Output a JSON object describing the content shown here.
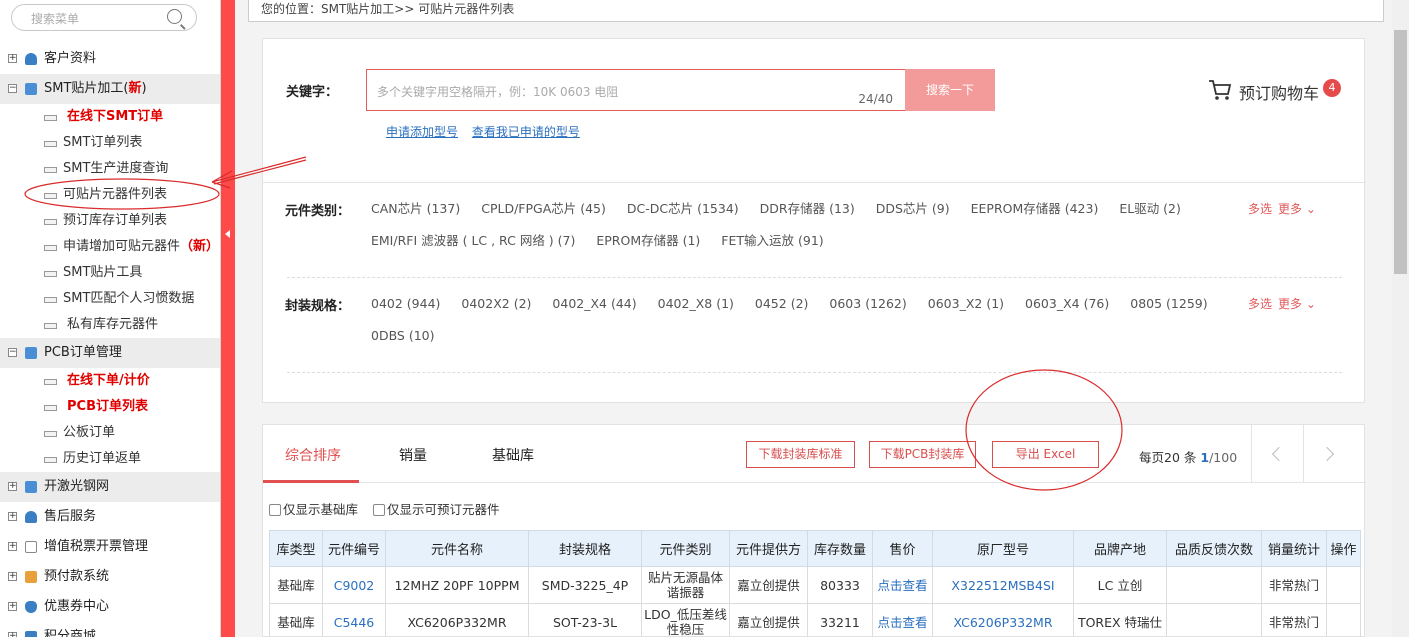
{
  "sidebar": {
    "search_placeholder": "搜索菜单",
    "groups": [
      {
        "label": "客户资料",
        "expander": "+",
        "icon": "user-icon",
        "color": "#3a7fc4"
      },
      {
        "label": "SMT贴片加工(",
        "new": "新",
        "close": ")",
        "expander": "−",
        "icon": "book-icon",
        "color": "#4a8ed6"
      },
      {
        "label": "PCB订单管理",
        "expander": "−",
        "icon": "book-icon",
        "color": "#4a8ed6"
      },
      {
        "label": "开激光钢网",
        "expander": "+",
        "icon": "book-icon",
        "color": "#4a8ed6"
      },
      {
        "label": "售后服务",
        "expander": "+",
        "icon": "user-icon",
        "color": "#3a7fc4"
      },
      {
        "label": "增值税票开票管理",
        "expander": "+",
        "icon": "document-icon",
        "color": "#888888"
      },
      {
        "label": "预付款系统",
        "expander": "+",
        "icon": "money-icon",
        "color": "#e8a13a"
      },
      {
        "label": "优惠券中心",
        "expander": "+",
        "icon": "shield-icon",
        "color": "#3a7fc4"
      },
      {
        "label": "积分商城",
        "expander": "+",
        "icon": "gift-icon",
        "color": "#3a7fc4"
      }
    ],
    "smt_items": [
      {
        "label": "在线下SMT订单"
      },
      {
        "label": "SMT订单列表"
      },
      {
        "label": "SMT生产进度查询"
      },
      {
        "label": "可贴片元器件列表"
      },
      {
        "label": "预订库存订单列表"
      },
      {
        "label": "申请增加可贴元器件",
        "new": "（新）"
      },
      {
        "label": "SMT贴片工具"
      },
      {
        "label": "SMT匹配个人习惯数据"
      },
      {
        "label": "私有库存元器件"
      }
    ],
    "pcb_items": [
      {
        "label": "在线下单/计价"
      },
      {
        "label": "PCB订单列表"
      },
      {
        "label": "公板订单"
      },
      {
        "label": "历史订单返单"
      }
    ]
  },
  "breadcrumb": "您的位置：SMT贴片加工>>  可贴片元器件列表",
  "search": {
    "label": "关键字：",
    "placeholder": "多个关键字用空格隔开，例：10K 0603 电阻",
    "counter": "24/40",
    "button": "搜索一下",
    "link_apply": "申请添加型号",
    "link_view": "查看我已申请的型号"
  },
  "cart": {
    "label": "预订购物车",
    "count": "4"
  },
  "filters": {
    "category": {
      "title": "元件类别：",
      "options": [
        "CAN芯片 (137)",
        "CPLD/FPGA芯片 (45)",
        "DC-DC芯片 (1534)",
        "DDR存储器 (13)",
        "DDS芯片 (9)",
        "EEPROM存储器 (423)",
        "EL驱动 (2)",
        "EMI/RFI 滤波器 ( LC , RC 网络 ) (7)",
        "EPROM存储器 (1)",
        "FET输入运放 (91)"
      ],
      "multi": "多选",
      "more": "更多"
    },
    "package": {
      "title": "封装规格：",
      "options": [
        "0402 (944)",
        "0402X2 (2)",
        "0402_X4 (44)",
        "0402_X8 (1)",
        "0452 (2)",
        "0603 (1262)",
        "0603_X2 (1)",
        "0603_X4 (76)",
        "0805 (1259)",
        "0DBS (10)"
      ],
      "multi": "多选",
      "more": "更多"
    }
  },
  "tabs": {
    "sort": "综合排序",
    "sales": "销量",
    "base": "基础库"
  },
  "buttons": {
    "download_std": "下载封装库标准",
    "download_pcb": "下载PCB封装库",
    "export": "导出 Excel"
  },
  "pager": {
    "per_page_label": "每页20",
    "unit": "条",
    "current": "1",
    "total": "/100"
  },
  "checkboxes": {
    "base_only": "仅显示基础库",
    "reservable_only": "仅显示可预订元器件"
  },
  "table": {
    "headers": [
      "库类型",
      "元件编号",
      "元件名称",
      "封装规格",
      "元件类别",
      "元件提供方",
      "库存数量",
      "售价",
      "原厂型号",
      "品牌产地",
      "品质反馈次数",
      "销量统计",
      "操作"
    ],
    "rows": [
      [
        "基础库",
        "C9002",
        "12MHZ 20PF 10PPM",
        "SMD-3225_4P",
        "贴片无源晶体谐振器",
        "嘉立创提供",
        "80333",
        "点击查看",
        "X322512MSB4SI",
        "LC 立创",
        "",
        "非常热门",
        ""
      ],
      [
        "基础库",
        "C5446",
        "XC6206P332MR",
        "SOT-23-3L",
        "LDO_低压差线性稳压",
        "嘉立创提供",
        "33211",
        "点击查看",
        "XC6206P332MR",
        "TOREX 特瑞仕",
        "",
        "非常热门",
        ""
      ]
    ]
  },
  "colors": {
    "accent": "#e05050",
    "link": "#2a6fbf",
    "header_bg": "#e6f1fb"
  }
}
